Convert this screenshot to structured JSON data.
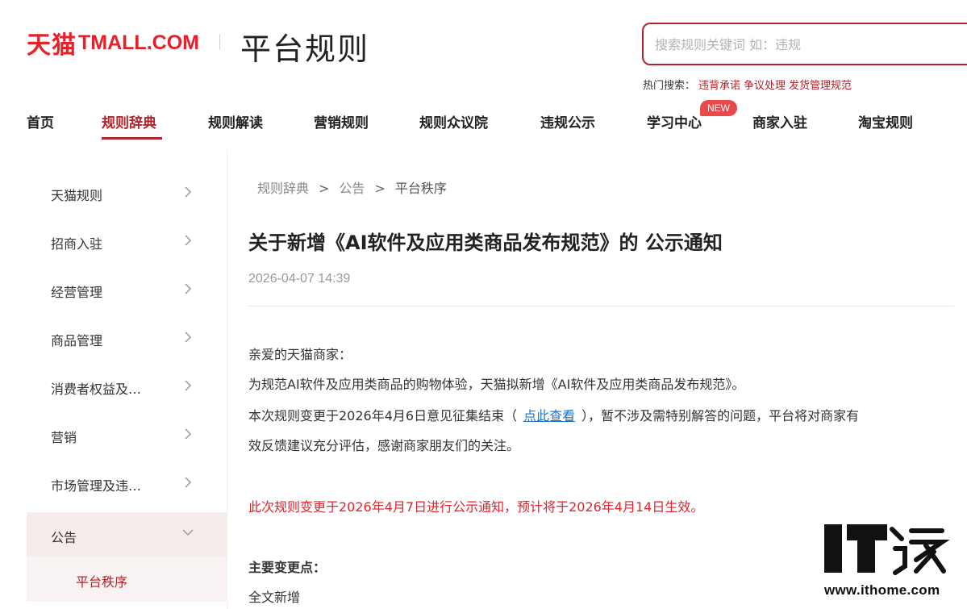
{
  "header": {
    "logo_cn": "天猫",
    "logo_en": "TMALL.COM",
    "site_title": "平台规则",
    "search_placeholder": "搜索规则关键词 如：违规",
    "hot_label": "热门搜索：",
    "hot_links": [
      "违背承诺",
      "争议处理",
      "发货管理规范"
    ]
  },
  "nav": {
    "items": [
      "首页",
      "规则辞典",
      "规则解读",
      "营销规则",
      "规则众议院",
      "违规公示",
      "学习中心",
      "商家入驻",
      "淘宝规则"
    ],
    "active": "规则辞典",
    "badge": "NEW"
  },
  "sidebar": {
    "items": [
      "天猫规则",
      "招商入驻",
      "经营管理",
      "商品管理",
      "消费者权益及…",
      "营销",
      "市场管理及违…",
      "公告"
    ],
    "sub_item": "平台秩序"
  },
  "breadcrumb": [
    "规则辞典",
    "公告",
    "平台秩序"
  ],
  "article": {
    "title": "关于新增《AI软件及应用类商品发布规范》的 公示通知",
    "date": "2026-04-07 14:39",
    "greeting": "亲爱的天猫商家：",
    "p1": "为规范AI软件及应用类商品的购物体验，天猫拟新增《AI软件及应用类商品发布规范》。",
    "p2_before": "本次规则变更于2026年4月6日意见征集结束（",
    "p2_link": "点此查看",
    "p2_after": "），暂不涉及需特别解答的问题，平台将对商家有",
    "p2_line2": "效反馈建议充分评估，感谢商家朋友们的关注。",
    "notice": "此次规则变更于2026年4月7日进行公示通知，预计将于2026年4月14日生效。",
    "changes_heading": "主要变更点：",
    "changes_first": "全文新增"
  },
  "watermark": {
    "brand": "IT之家",
    "url": "www.ithome.com"
  },
  "colors": {
    "brand_red": "#e6212a",
    "accent": "#b0242c",
    "link": "#1a73c7",
    "notice_red": "#e3232b",
    "badge": "#e8494b"
  }
}
